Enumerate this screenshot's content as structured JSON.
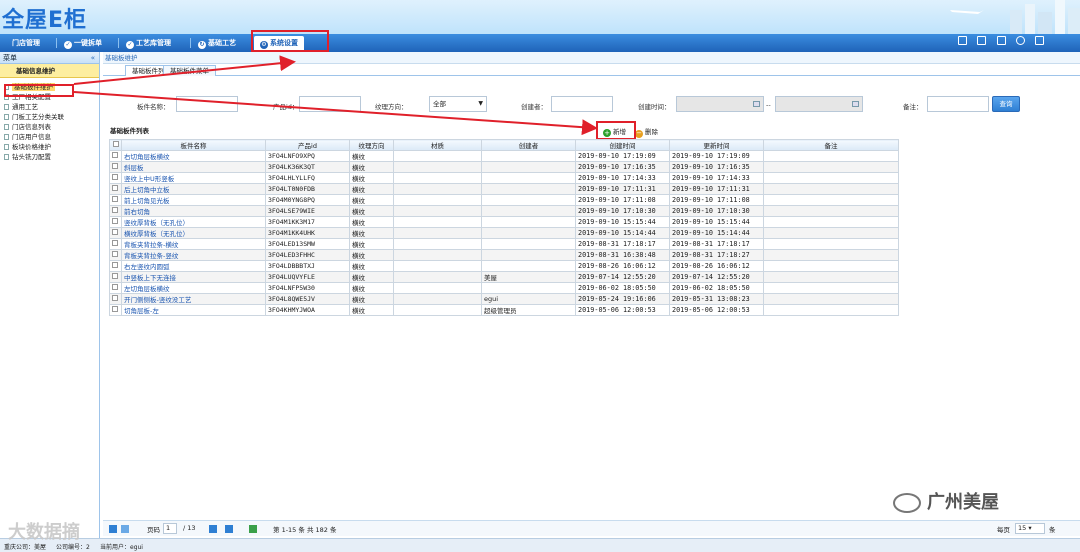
{
  "header": {
    "logo": "全屋E柜"
  },
  "nav": {
    "items": [
      {
        "label": "门店管理"
      },
      {
        "label": "一键拆单"
      },
      {
        "label": "工艺库管理"
      },
      {
        "label": "基础工艺"
      },
      {
        "label": "系统设置"
      }
    ]
  },
  "sidebar": {
    "title": "菜单",
    "collapse": "«",
    "group": "基础信息维护",
    "items": [
      {
        "label": "基础板件维护"
      },
      {
        "label": "工厂相关配置"
      },
      {
        "label": "通用工艺"
      },
      {
        "label": "门板工艺分类关联"
      },
      {
        "label": "门店信息列表"
      },
      {
        "label": "门店用户信息"
      },
      {
        "label": "板块价格维护"
      },
      {
        "label": "钻头铣刀配置"
      }
    ]
  },
  "main": {
    "breadcrumb": "基础板维护",
    "tabs": [
      {
        "label": "基础板件列表"
      },
      {
        "label": "基础板件菜单"
      }
    ],
    "filters": {
      "name_label": "板件名称：",
      "product_label": "产品id：",
      "grain_label": "纹理方向：",
      "grain_value": "全部",
      "creator_label": "创建者：",
      "created_label": "创建时间：",
      "range_sep": "--",
      "remark_label": "备注：",
      "query": "查询"
    },
    "grid": {
      "title": "基础板件列表",
      "add": "新增",
      "delete": "删除",
      "columns": [
        "板件名称",
        "产品id",
        "纹理方向",
        "材质",
        "创建者",
        "创建时间",
        "更新时间",
        "备注"
      ],
      "rows": [
        {
          "name": "右切角层板横纹",
          "pid": "3FO4LNFO9XPQ",
          "grain": "横纹",
          "mat": "",
          "creator": "",
          "created": "2019-09-10 17:19:09",
          "updated": "2019-09-10 17:19:09"
        },
        {
          "name": "斜层板",
          "pid": "3FO4LK36K3QT",
          "grain": "横纹",
          "mat": "",
          "creator": "",
          "created": "2019-09-10 17:16:35",
          "updated": "2019-09-10 17:16:35"
        },
        {
          "name": "竖纹上中U形竖板",
          "pid": "3FO4LHLYLLFQ",
          "grain": "横纹",
          "mat": "",
          "creator": "",
          "created": "2019-09-10 17:14:33",
          "updated": "2019-09-10 17:14:33"
        },
        {
          "name": "后上切角中立板",
          "pid": "3FO4LT0N0FDB",
          "grain": "横纹",
          "mat": "",
          "creator": "",
          "created": "2019-09-10 17:11:31",
          "updated": "2019-09-10 17:11:31"
        },
        {
          "name": "前上切角见光板",
          "pid": "3FO4M0YNG8PQ",
          "grain": "横纹",
          "mat": "",
          "creator": "",
          "created": "2019-09-10 17:11:08",
          "updated": "2019-09-10 17:11:08"
        },
        {
          "name": "前右切角",
          "pid": "3FO4LSE79WIE",
          "grain": "横纹",
          "mat": "",
          "creator": "",
          "created": "2019-09-10 17:10:30",
          "updated": "2019-09-10 17:10:30"
        },
        {
          "name": "竖纹厚背板（无孔位）",
          "pid": "3FO4M1KK3M17",
          "grain": "横纹",
          "mat": "",
          "creator": "",
          "created": "2019-09-10 15:15:44",
          "updated": "2019-09-10 15:15:44"
        },
        {
          "name": "横纹厚背板（无孔位）",
          "pid": "3FO4M1KK4UHK",
          "grain": "横纹",
          "mat": "",
          "creator": "",
          "created": "2019-09-10 15:14:44",
          "updated": "2019-09-10 15:14:44"
        },
        {
          "name": "背板夹背拉条-横纹",
          "pid": "3FO4LED13SMW",
          "grain": "横纹",
          "mat": "",
          "creator": "",
          "created": "2019-08-31 17:18:17",
          "updated": "2019-08-31 17:18:17"
        },
        {
          "name": "背板夹背拉条-竖纹",
          "pid": "3FO4LED3FHHC",
          "grain": "横纹",
          "mat": "",
          "creator": "",
          "created": "2019-08-31 16:38:48",
          "updated": "2019-08-31 17:18:27"
        },
        {
          "name": "右左竖纹内圆弧",
          "pid": "3FO4LDBBBTXJ",
          "grain": "横纹",
          "mat": "",
          "creator": "",
          "created": "2019-08-26 16:06:12",
          "updated": "2019-08-26 16:06:12"
        },
        {
          "name": "中竖板上下无连接",
          "pid": "3FO4LUQVYFLE",
          "grain": "横纹",
          "mat": "",
          "creator": "美屋",
          "created": "2019-07-14 12:55:20",
          "updated": "2019-07-14 12:55:20"
        },
        {
          "name": "左切角层板横纹",
          "pid": "3FO4LNFP5W30",
          "grain": "横纹",
          "mat": "",
          "creator": "",
          "created": "2019-06-02 18:05:50",
          "updated": "2019-06-02 18:05:50"
        },
        {
          "name": "开门侧侧板-竖纹没工艺",
          "pid": "3FO4L8QWE5JV",
          "grain": "横纹",
          "mat": "",
          "creator": "egui",
          "created": "2019-05-24 19:16:06",
          "updated": "2019-05-31 13:08:23"
        },
        {
          "name": "切角层板-左",
          "pid": "3FO4KHMYJWOA",
          "grain": "横纹",
          "mat": "",
          "creator": "超级管理员",
          "created": "2019-05-06 12:00:53",
          "updated": "2019-05-06 12:00:53"
        }
      ]
    }
  },
  "pager": {
    "page_label": "页码",
    "page": "1",
    "of": "/ 13",
    "summary": "第 1-15 条  共 182 条",
    "per_page_label": "每页",
    "per_page": "15",
    "per_page_unit": "条"
  },
  "status": {
    "company": "重庆公司：美屋",
    "code": "公司编号：2",
    "user": "当前用户：egui"
  },
  "watermarks": {
    "left": "大数据摘",
    "right": "广州美屋"
  },
  "colors": {
    "highlight": "#e0202a",
    "nav": "#1f63b8"
  }
}
